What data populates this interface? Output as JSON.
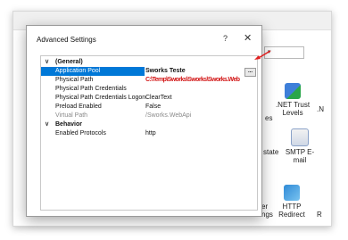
{
  "background_app": {
    "dropdown_value": "",
    "icons": [
      {
        "label": "es",
        "icon": "partial-text"
      },
      {
        "label": ".NET Trust\nLevels",
        "icon": "shield-check-icon"
      },
      {
        "label": ".N",
        "icon": "partial-text"
      },
      {
        "label": "state",
        "icon": "partial-text"
      },
      {
        "label": "SMTP E-mail",
        "icon": "envelope-icon"
      },
      {
        "label": "HTTP\nRedirect",
        "icon": "redirect-icon"
      },
      {
        "label": "R",
        "icon": "partial-text"
      },
      {
        "label": "er\nngs",
        "icon": "partial-text"
      }
    ]
  },
  "dialog": {
    "title": "Advanced Settings",
    "help_glyph": "?",
    "close_glyph": "✕",
    "grid": [
      {
        "type": "category",
        "name": "(General)",
        "expanded": true
      },
      {
        "type": "property",
        "name": "Application Pool",
        "value": "Sworks Teste",
        "selected": true,
        "has_ellipsis": true,
        "ellipsis_label": "..."
      },
      {
        "type": "property",
        "name": "Physical Path",
        "value": "C:\\Temp\\Sworks\\Sworks\\Sworks.Web",
        "redacted": true
      },
      {
        "type": "property",
        "name": "Physical Path Credentials",
        "value": ""
      },
      {
        "type": "property",
        "name": "Physical Path Credentials Logon",
        "value": "ClearText"
      },
      {
        "type": "property",
        "name": "Preload Enabled",
        "value": "False"
      },
      {
        "type": "property",
        "name": "Virtual Path",
        "value": "/Sworks.WebApi",
        "disabled": true
      },
      {
        "type": "category",
        "name": "Behavior",
        "expanded": true
      },
      {
        "type": "property",
        "name": "Enabled Protocols",
        "value": "http"
      }
    ]
  },
  "colors": {
    "selection": "#0078d7",
    "annotation_arrow": "#e02020",
    "redaction": "#d21515"
  }
}
